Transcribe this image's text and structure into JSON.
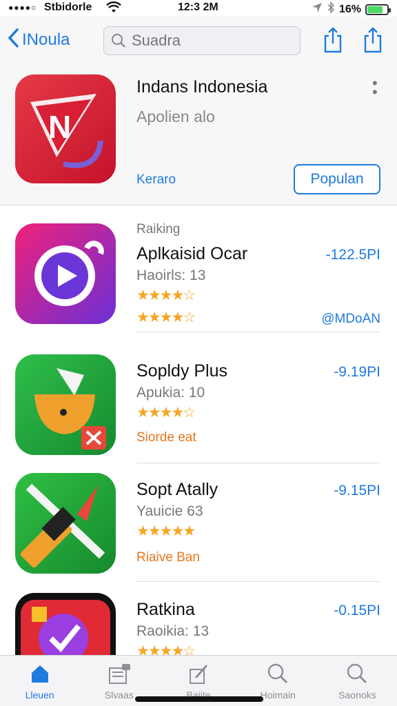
{
  "status_bar": {
    "signal": "●●●●○",
    "carrier": "Stbidorle",
    "time": "12:3 2M",
    "battery": "16%"
  },
  "nav": {
    "back_label": "INoula",
    "search_placeholder": "Suadra",
    "share_icon": "share-icon"
  },
  "featured": {
    "title": "Indans Indonesia",
    "subtitle": "Apolien alo",
    "link": "Keraro",
    "button": "Populan",
    "icon_color": "#d81f35"
  },
  "apps": [
    {
      "kicker": "Raiking",
      "name": "Aplkaisid Ocar",
      "sub": "Haoirls: 13",
      "stars_row1": "★★★★☆",
      "stars_row2": "★★★★☆",
      "price": "-122.5PI",
      "extra": "@MDoAN",
      "icon_color": "#d4227a"
    },
    {
      "kicker": "",
      "name": "Sopldy Plus",
      "sub": "Apukia: 10",
      "stars_row1": "★★★★☆",
      "price": "-9.19PI",
      "tag": "Siorde eat",
      "icon_color": "#1e9f3a"
    },
    {
      "kicker": "",
      "name": "Sopt Atally",
      "sub": "Yauicie 63",
      "stars_row1": "★★★★★",
      "price": "-9.15PI",
      "tag": "Riaive Ban",
      "icon_color": "#1d9a35"
    },
    {
      "kicker": "",
      "name": "Ratkina",
      "sub": "Raoikia: 13",
      "stars_row1": "★★★★☆",
      "price": "-0.15PI",
      "icon_color": "#e02a35"
    }
  ],
  "tabs": [
    {
      "label": "Lleuen",
      "icon": "home-icon",
      "active": true
    },
    {
      "label": "Slvaas",
      "icon": "document-icon",
      "active": false
    },
    {
      "label": "Baiite",
      "icon": "edit-icon",
      "active": false
    },
    {
      "label": "Hoimain",
      "icon": "search-icon",
      "active": false
    },
    {
      "label": "Saonoks",
      "icon": "search-icon",
      "active": false
    }
  ],
  "colors": {
    "accent": "#1f7ae0",
    "star": "#f5a623",
    "orange_tag": "#e8761c"
  }
}
